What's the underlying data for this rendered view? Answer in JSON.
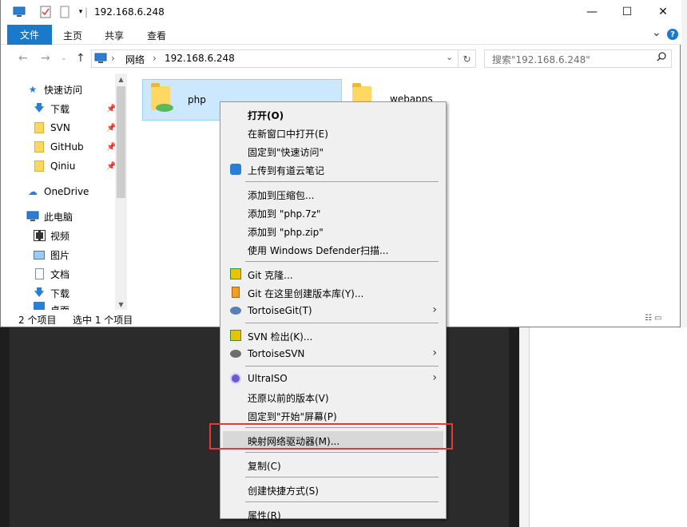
{
  "window": {
    "title": "192.168.6.248",
    "minimize": "—",
    "maximize": "☐",
    "close": "✕"
  },
  "ribbon": {
    "tabs": [
      "文件",
      "主页",
      "共享",
      "查看"
    ],
    "expand": "⌄",
    "help": "?"
  },
  "address": {
    "segments": [
      "网络",
      "192.168.6.248"
    ],
    "sep": "›",
    "search_placeholder": "搜索\"192.168.6.248\""
  },
  "nav": {
    "quick_access": "快速访问",
    "items": [
      {
        "label": "下载",
        "icon": "download-arrow-icon",
        "pinned": true
      },
      {
        "label": "SVN",
        "icon": "folder-icon",
        "pinned": true
      },
      {
        "label": "GitHub",
        "icon": "folder-icon",
        "pinned": true
      },
      {
        "label": "Qiniu",
        "icon": "folder-icon",
        "pinned": true
      }
    ],
    "onedrive": "OneDrive",
    "this_pc": "此电脑",
    "pc_items": [
      {
        "label": "视频",
        "icon": "video-icon"
      },
      {
        "label": "图片",
        "icon": "pictures-icon"
      },
      {
        "label": "文档",
        "icon": "documents-icon"
      },
      {
        "label": "下载",
        "icon": "download-arrow-icon"
      }
    ],
    "cut_label": "桌面"
  },
  "content": {
    "items": [
      {
        "label": "php",
        "selected": true
      },
      {
        "label": "webapps",
        "selected": false
      }
    ]
  },
  "status": {
    "count": "2 个项目",
    "selected": "选中 1 个项目"
  },
  "context_menu": {
    "items": [
      {
        "label": "打开(O)",
        "bold": true,
        "icon": ""
      },
      {
        "label": "在新窗口中打开(E)",
        "icon": ""
      },
      {
        "label": "固定到\"快速访问\"",
        "icon": ""
      },
      {
        "label": "上传到有道云笔记",
        "icon": "youdao-note-icon"
      },
      {
        "sep": true
      },
      {
        "label": "添加到压缩包...",
        "icon": ""
      },
      {
        "label": "添加到 \"php.7z\"",
        "icon": ""
      },
      {
        "label": "添加到 \"php.zip\"",
        "icon": ""
      },
      {
        "label": "使用 Windows Defender扫描...",
        "icon": ""
      },
      {
        "sep": true
      },
      {
        "label": "Git 克隆...",
        "icon": "git-clone-icon"
      },
      {
        "label": "Git 在这里创建版本库(Y)...",
        "icon": "git-repo-icon"
      },
      {
        "label": "TortoiseGit(T)",
        "icon": "tortoisegit-icon",
        "submenu": true
      },
      {
        "sep": true
      },
      {
        "label": "SVN 检出(K)...",
        "icon": "svn-checkout-icon"
      },
      {
        "label": "TortoiseSVN",
        "icon": "tortoisesvn-icon",
        "submenu": true
      },
      {
        "sep": true
      },
      {
        "label": "UltraISO",
        "icon": "ultraiso-icon",
        "submenu": true
      },
      {
        "label": "还原以前的版本(V)",
        "icon": ""
      },
      {
        "label": "固定到\"开始\"屏幕(P)",
        "icon": ""
      },
      {
        "sep": true
      },
      {
        "label": "映射网络驱动器(M)...",
        "icon": "",
        "hover": true
      },
      {
        "sep": true
      },
      {
        "label": "复制(C)",
        "icon": ""
      },
      {
        "sep": true
      },
      {
        "label": "创建快捷方式(S)",
        "icon": ""
      },
      {
        "sep": true
      },
      {
        "label": "属性(R)",
        "icon": ""
      }
    ]
  },
  "colors": {
    "accent": "#1979ca",
    "selection": "#cce8ff",
    "highlight_box": "#e53935"
  }
}
